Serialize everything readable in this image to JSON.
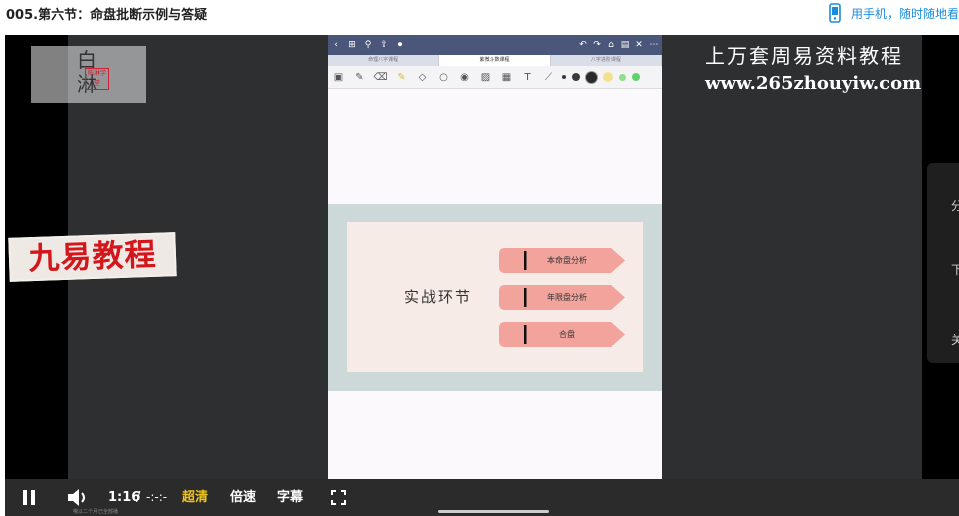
{
  "header": {
    "title": "005.第六节：命盘批断示例与答疑",
    "mobile_link": "用手机，随时随地看"
  },
  "video": {
    "watermark_logo": "白淋",
    "watermark_seal": "陈淋学堂",
    "badge_text": "九易教程",
    "promo_line1": "上万套周易资料教程",
    "promo_line2": "www.265zhouyiw.com",
    "ipad": {
      "tabs": [
        "命理八字课程",
        "紫微斗数课程",
        "八字进阶课程"
      ],
      "toolbar_colors": [
        "#3a3a3a",
        "#3a3a3a",
        "#2a2a2a",
        "#f3e28a",
        "#8fe08a",
        "#5fd36a"
      ],
      "slide": {
        "title": "实战环节",
        "items": [
          "本命盘分析",
          "年限盘分析",
          "合盘"
        ],
        "accent_color": "#f2a39c"
      }
    }
  },
  "controls": {
    "current_time": "1:16",
    "separator": "/",
    "duration": "-:-:-",
    "quality": "超清",
    "speed": "倍速",
    "subtitles": "字幕",
    "tiny_caption": "哦以二个月已全部播"
  },
  "side_panel": {
    "items": [
      "分",
      "下",
      "关"
    ]
  }
}
